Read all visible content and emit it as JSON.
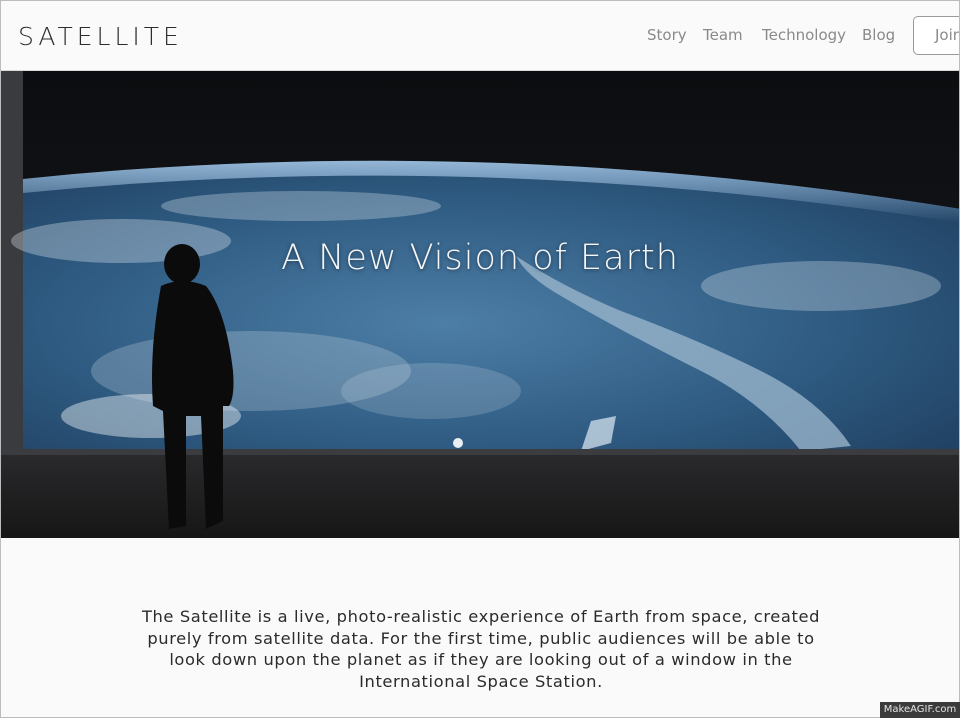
{
  "header": {
    "logo": "SATELLITE",
    "nav": [
      "Story",
      "Team",
      "Technology",
      "Blog"
    ],
    "join_label": "Join"
  },
  "hero": {
    "title": "A New Vision of Earth"
  },
  "description": "The Satellite is a live, photo-realistic experience of Earth from space, created purely from satellite data. For the first time, public audiences will be able to look down upon the planet as if they are looking out of a window in the International Space Station.",
  "watermark": "MakeAGIF.com",
  "colors": {
    "page_bg": "#fafafa",
    "text_dark": "#2b2b2b",
    "nav_gray": "#8a8a8a",
    "space_dark": "#141516",
    "earth_blue": "#3c6a93"
  }
}
